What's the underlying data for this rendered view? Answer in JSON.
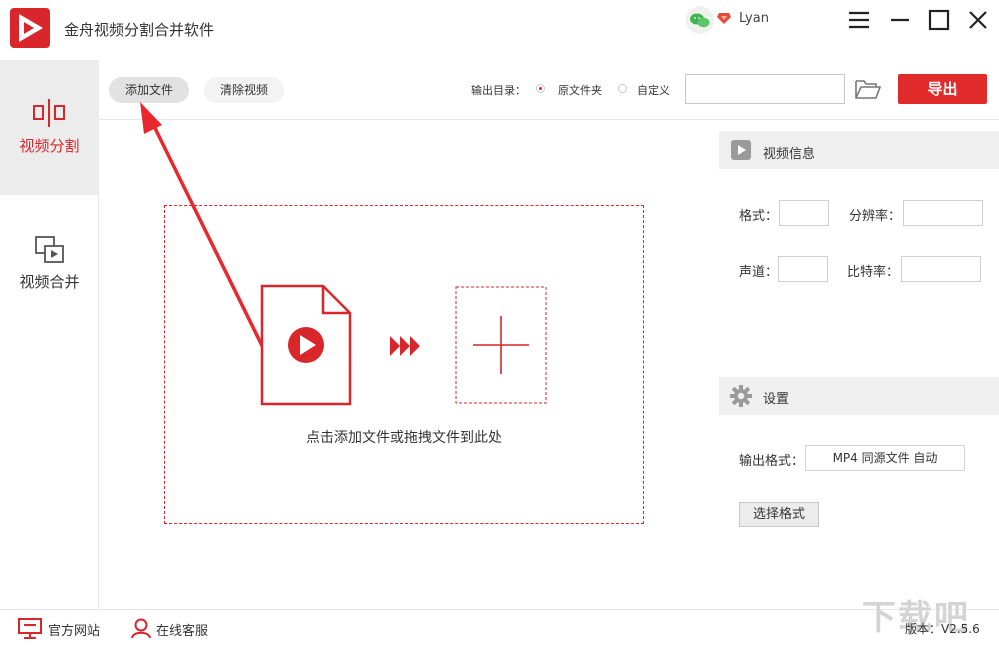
{
  "window": {
    "title": "金舟视频分割合并软件",
    "user_name": "Lyan"
  },
  "sidebar": {
    "items": [
      {
        "label": "视频分割",
        "active": true
      },
      {
        "label": "视频合并",
        "active": false
      }
    ]
  },
  "toolbar": {
    "add_label": "添加文件",
    "clear_label": "清除视频",
    "output_dir_label": "输出目录：",
    "option_original": "原文件夹",
    "option_custom": "自定义",
    "output_path": "",
    "export_label": "导出"
  },
  "dropzone": {
    "hint": "点击添加文件或拖拽文件到此处"
  },
  "video_info": {
    "title": "视频信息",
    "format_label": "格式：",
    "format_value": "",
    "resolution_label": "分辨率：",
    "resolution_value": "",
    "channel_label": "声道：",
    "channel_value": "",
    "bitrate_label": "比特率：",
    "bitrate_value": ""
  },
  "settings": {
    "title": "设置",
    "output_format_label": "输出格式：",
    "output_format_value": "MP4 同源文件 自动",
    "choose_format_label": "选择格式"
  },
  "statusbar": {
    "website_label": "官方网站",
    "support_label": "在线客服",
    "version_text": "版本：V2.5.6"
  },
  "watermark": "下载吧",
  "colors": {
    "accent": "#d9262b",
    "export_button": "#e12b2b",
    "wechat": "#3fb34f"
  }
}
